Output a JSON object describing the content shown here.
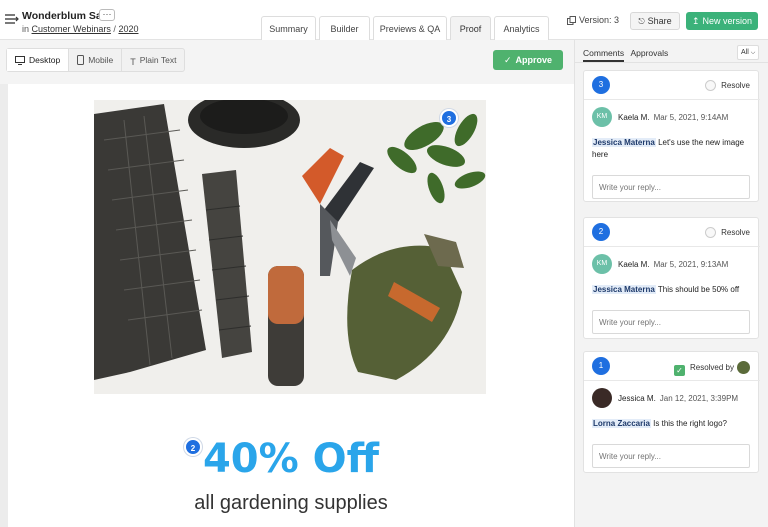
{
  "header": {
    "title": "Wonderblum Sale",
    "more_label": "···",
    "crumb_prefix": "in",
    "crumb_folder": "Customer Webinars",
    "crumb_sep": "/",
    "crumb_year": "2020",
    "tabs": [
      {
        "label": "Summary"
      },
      {
        "label": "Builder"
      },
      {
        "label": "Previews & QA"
      },
      {
        "label": "Proof"
      },
      {
        "label": "Analytics"
      }
    ],
    "active_tab": "Proof",
    "version": "Version: 3",
    "share_label": "Share",
    "new_version_label": "New version"
  },
  "toolbar": {
    "views": [
      {
        "label": "Desktop",
        "icon": "desktop-icon"
      },
      {
        "label": "Mobile",
        "icon": "mobile-icon"
      },
      {
        "label": "Plain Text",
        "icon": "text-icon"
      }
    ],
    "active_view": "Desktop",
    "approve_label": "Approve"
  },
  "email": {
    "headline": "40% Off",
    "subline": "all gardening supplies",
    "pin_photo": "3",
    "pin_headline": "2"
  },
  "panel": {
    "tabs": [
      "Comments",
      "Approvals"
    ],
    "active_tab": "Comments",
    "filter": "All",
    "comments": [
      {
        "number": "3",
        "resolve_label": "Resolve",
        "initials": "KM",
        "author": "Kaela M.",
        "when": "Mar 5, 2021, 9:14AM",
        "mention": "Jessica Materna",
        "text": "Let's use the new image here",
        "reply_placeholder": "Write your reply..."
      },
      {
        "number": "2",
        "resolve_label": "Resolve",
        "initials": "KM",
        "author": "Kaela M.",
        "when": "Mar 5, 2021, 9:13AM",
        "mention": "Jessica Materna",
        "text": "This should be 50% off",
        "reply_placeholder": "Write your reply..."
      },
      {
        "number": "1",
        "resolve_label": "Resolved by",
        "author": "Jessica M.",
        "when": "Jan 12, 2021, 3:39PM",
        "mention": "Lorna Zaccaria",
        "text": "Is this the right logo?",
        "reply_placeholder": "Write your reply..."
      }
    ]
  },
  "colors": {
    "accent_green": "#3bb27a",
    "approve_green": "#4fb26e",
    "pin_blue": "#1f6fe0",
    "headline_blue": "#2aa5ea"
  }
}
